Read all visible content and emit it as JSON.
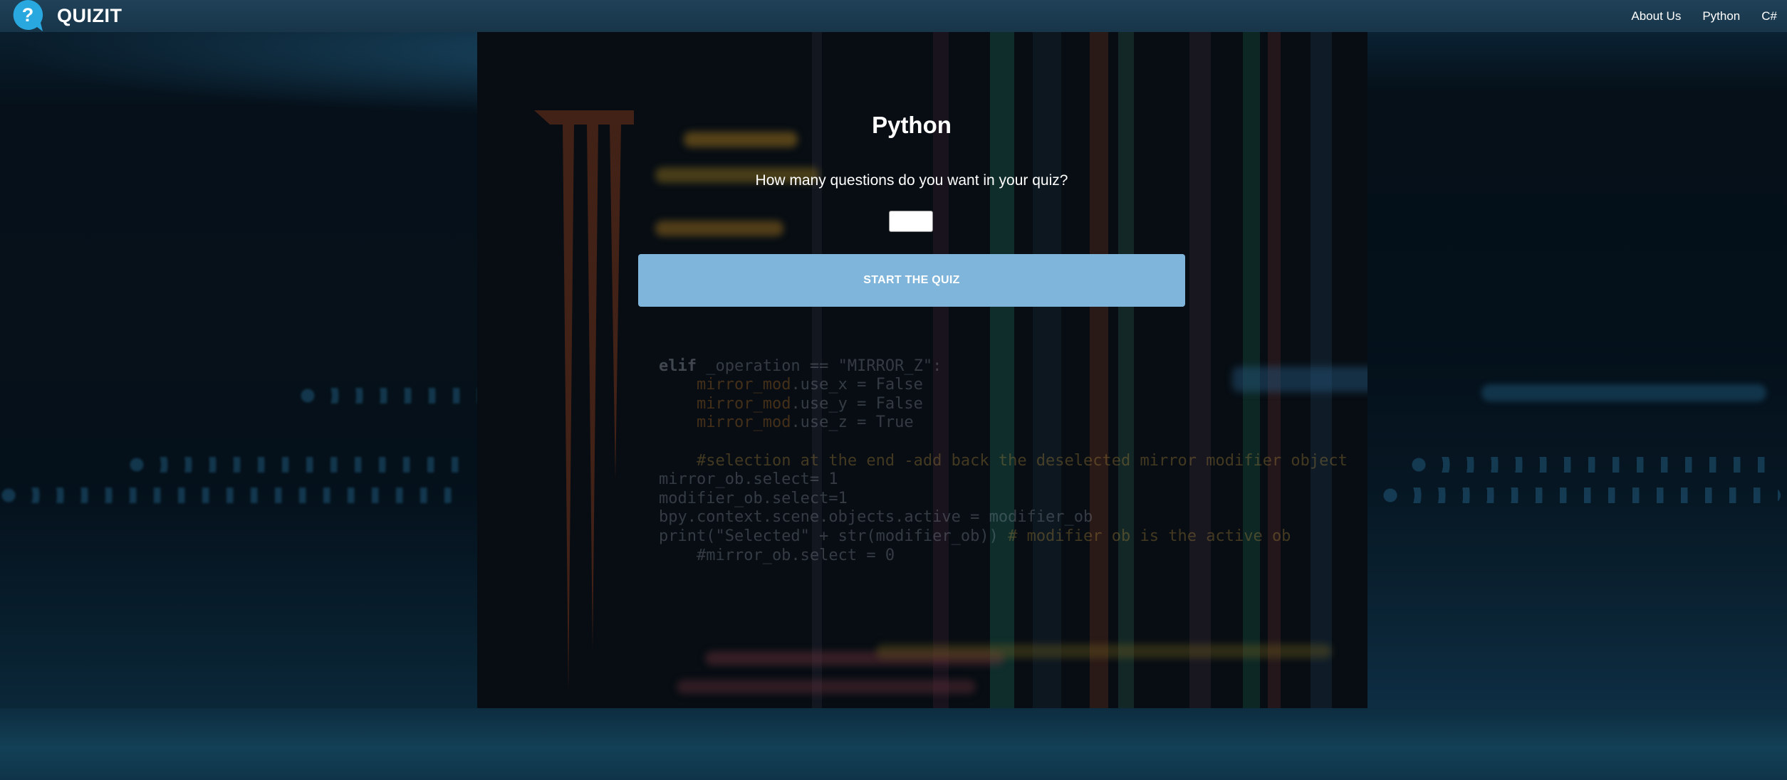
{
  "navbar": {
    "brand": "QUIZIT",
    "logo_icon": "question-bubble-icon",
    "logo_glyph": "?",
    "links": [
      {
        "label": "About Us"
      },
      {
        "label": "Python"
      },
      {
        "label": "C#"
      }
    ]
  },
  "main": {
    "title": "Python",
    "question": "How many questions do you want in your quiz?",
    "count_input": {
      "value": "",
      "placeholder": ""
    },
    "start_button": "START THE QUIZ"
  },
  "colors": {
    "navbar": "#1c3b50",
    "button": "#7fb5db",
    "logo": "#29a8e0"
  }
}
